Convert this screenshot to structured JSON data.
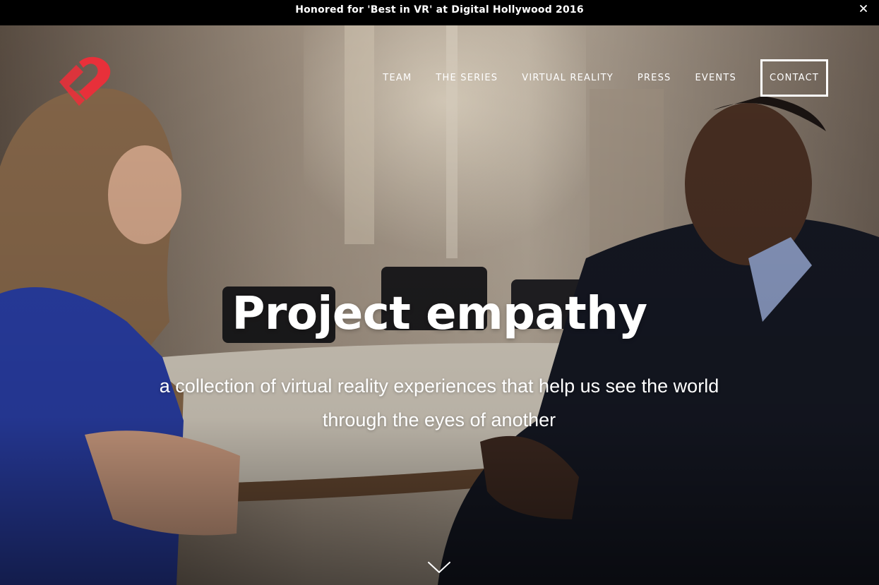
{
  "announcement": {
    "text": "Honored for 'Best in VR' at Digital Hollywood 2016",
    "close_icon": "close-icon"
  },
  "brand": {
    "logo_icon": "heart-logo-icon",
    "logo_color": "#e8303a"
  },
  "nav": {
    "items": [
      {
        "label": "TEAM"
      },
      {
        "label": "THE SERIES"
      },
      {
        "label": "VIRTUAL REALITY"
      },
      {
        "label": "PRESS"
      },
      {
        "label": "EVENTS"
      }
    ],
    "contact_label": "CONTACT"
  },
  "hero": {
    "title": "Project empathy",
    "subtitle": "a collection of virtual reality experiences that help us see the world through the eyes of another",
    "scroll_icon": "chevron-down-icon"
  }
}
